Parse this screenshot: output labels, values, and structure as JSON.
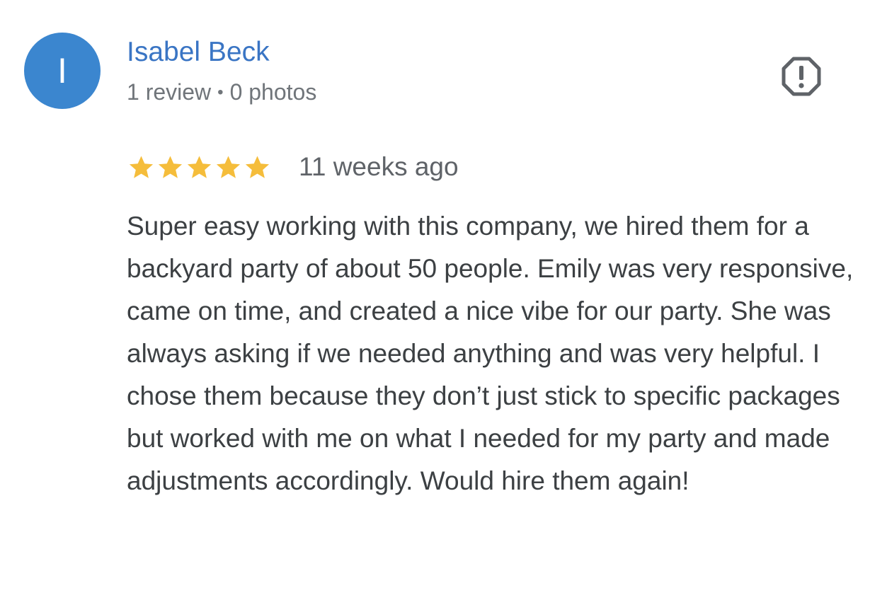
{
  "review": {
    "avatar_letter": "I",
    "avatar_color": "#3b86cf",
    "reviewer_name": "Isabel Beck",
    "review_count": "1 review",
    "separator": "•",
    "photo_count": "0 photos",
    "rating": 5,
    "rating_max": 5,
    "star_color": "#f5bd3b",
    "date": "11 weeks ago",
    "text": "Super easy working with this company, we hired them for a backyard party of about 50 people. Emily was very responsive, came on time, and created a nice vibe for our party. She was always asking if we needed anything and was very helpful. I chose them because they don’t just stick to specific packages but worked with me on what I needed for my party and made adjustments accordingly. Would hire them again!",
    "flag_icon": "report-octagon-icon"
  }
}
